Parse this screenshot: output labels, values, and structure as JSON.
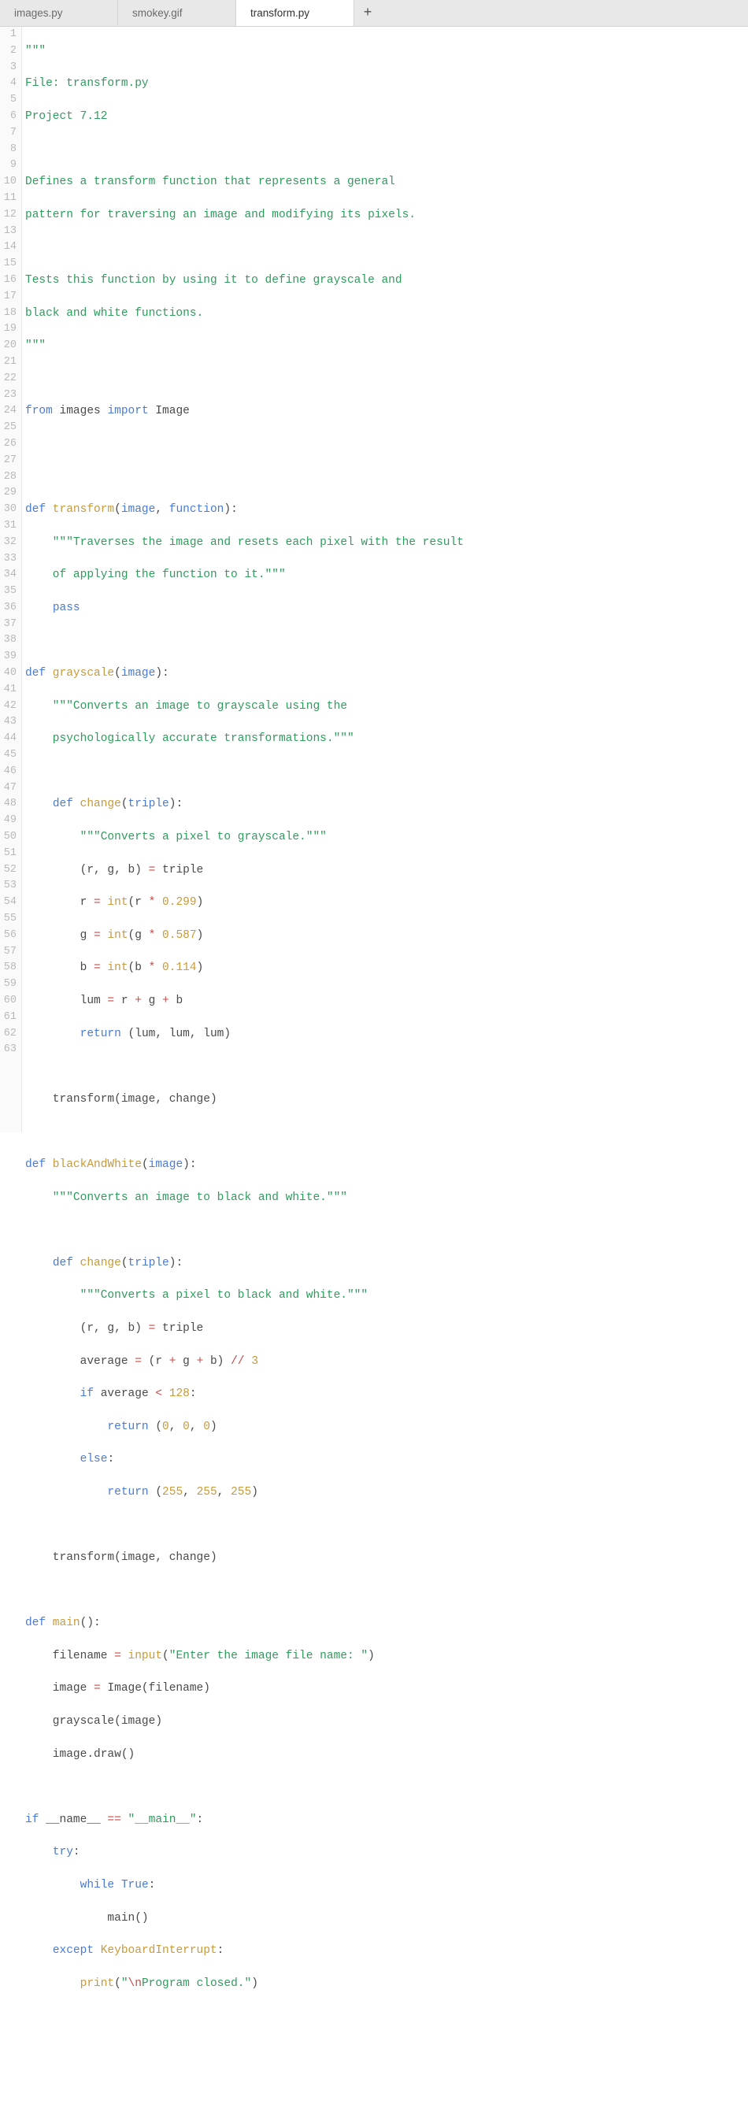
{
  "tabs": [
    {
      "label": "images.py",
      "active": false
    },
    {
      "label": "smokey.gif",
      "active": false
    },
    {
      "label": "transform.py",
      "active": true
    }
  ],
  "addTabGlyph": "+",
  "gutterStart": 1,
  "gutterEnd": 63,
  "code": {
    "l1": "\"\"\"",
    "l2": "File: transform.py",
    "l3": "Project 7.12",
    "l4": "",
    "l5": "Defines a transform function that represents a general",
    "l6": "pattern for traversing an image and modifying its pixels.",
    "l7": "",
    "l8": "Tests this function by using it to define grayscale and",
    "l9": "black and white functions.",
    "l10": "\"\"\"",
    "l11": "",
    "l12_from": "from",
    "l12_mod": " images ",
    "l12_imp": "import",
    "l12_name": " Image",
    "l13": "",
    "l14": "",
    "l15_def": "def",
    "l15_name": " transform",
    "l15_p1": "image",
    "l15_p2": "function",
    "l16": "    \"\"\"Traverses the image and resets each pixel with the result",
    "l17": "    of applying the function to it.\"\"\"",
    "l18_indent": "    ",
    "l18_pass": "pass",
    "l19": "",
    "l20_def": "def",
    "l20_name": " grayscale",
    "l20_p1": "image",
    "l21": "    \"\"\"Converts an image to grayscale using the",
    "l22": "    psychologically accurate transformations.\"\"\"",
    "l23": "",
    "l24_indent": "    ",
    "l24_def": "def",
    "l24_name": " change",
    "l24_p1": "triple",
    "l25": "        \"\"\"Converts a pixel to grayscale.\"\"\"",
    "l26_a": "        (r, g, b) ",
    "l26_eq": "=",
    "l26_b": " triple",
    "l27_a": "        r ",
    "l27_eq": "=",
    "l27_int": " int",
    "l27_lp": "(r ",
    "l27_op": "*",
    "l27_sp": " ",
    "l27_num": "0.299",
    "l27_rp": ")",
    "l28_a": "        g ",
    "l28_eq": "=",
    "l28_int": " int",
    "l28_lp": "(g ",
    "l28_op": "*",
    "l28_sp": " ",
    "l28_num": "0.587",
    "l28_rp": ")",
    "l29_a": "        b ",
    "l29_eq": "=",
    "l29_int": " int",
    "l29_lp": "(b ",
    "l29_op": "*",
    "l29_sp": " ",
    "l29_num": "0.114",
    "l29_rp": ")",
    "l30_a": "        lum ",
    "l30_eq": "=",
    "l30_b": " r ",
    "l30_p1": "+",
    "l30_c": " g ",
    "l30_p2": "+",
    "l30_d": " b",
    "l31_indent": "        ",
    "l31_ret": "return",
    "l31_rest": " (lum, lum, lum)",
    "l32": "",
    "l33": "    transform(image, change)",
    "l34": "",
    "l35_def": "def",
    "l35_name": " blackAndWhite",
    "l35_p1": "image",
    "l36": "    \"\"\"Converts an image to black and white.\"\"\"",
    "l37": "",
    "l38_indent": "    ",
    "l38_def": "def",
    "l38_name": " change",
    "l38_p1": "triple",
    "l39": "        \"\"\"Converts a pixel to black and white.\"\"\"",
    "l40_a": "        (r, g, b) ",
    "l40_eq": "=",
    "l40_b": " triple",
    "l41_a": "        average ",
    "l41_eq": "=",
    "l41_b": " (r ",
    "l41_p1": "+",
    "l41_c": " g ",
    "l41_p2": "+",
    "l41_d": " b) ",
    "l41_fd": "//",
    "l41_sp": " ",
    "l41_num": "3",
    "l42_indent": "        ",
    "l42_if": "if",
    "l42_a": " average ",
    "l42_lt": "<",
    "l42_sp": " ",
    "l42_num": "128",
    "l42_col": ":",
    "l43_indent": "            ",
    "l43_ret": "return",
    "l43_lp": " (",
    "l43_n1": "0",
    "l43_c1": ", ",
    "l43_n2": "0",
    "l43_c2": ", ",
    "l43_n3": "0",
    "l43_rp": ")",
    "l44_indent": "        ",
    "l44_else": "else",
    "l44_col": ":",
    "l45_indent": "            ",
    "l45_ret": "return",
    "l45_lp": " (",
    "l45_n1": "255",
    "l45_c1": ", ",
    "l45_n2": "255",
    "l45_c2": ", ",
    "l45_n3": "255",
    "l45_rp": ")",
    "l46": "",
    "l47": "    transform(image, change)",
    "l48": "",
    "l49_def": "def",
    "l49_name": " main",
    "l50_a": "    filename ",
    "l50_eq": "=",
    "l50_sp": " ",
    "l50_input": "input",
    "l50_lp": "(",
    "l50_str": "\"Enter the image file name: \"",
    "l50_rp": ")",
    "l51_a": "    image ",
    "l51_eq": "=",
    "l51_b": " Image(filename)",
    "l52": "    grayscale(image)",
    "l53": "    image.draw()",
    "l54": "",
    "l55_if": "if",
    "l55_a": " __name__ ",
    "l55_eq": "==",
    "l55_sp": " ",
    "l55_str": "\"__main__\"",
    "l55_col": ":",
    "l56_indent": "    ",
    "l56_try": "try",
    "l56_col": ":",
    "l57_indent": "        ",
    "l57_while": "while",
    "l57_sp": " ",
    "l57_true": "True",
    "l57_col": ":",
    "l58": "            main()",
    "l59_indent": "    ",
    "l59_except": "except",
    "l59_sp": " ",
    "l59_exc": "KeyboardInterrupt",
    "l59_col": ":",
    "l60_indent": "        ",
    "l60_print": "print",
    "l60_lp": "(",
    "l60_q1": "\"",
    "l60_esc": "\\n",
    "l60_rest": "Program closed.\"",
    "l60_rp": ")"
  }
}
